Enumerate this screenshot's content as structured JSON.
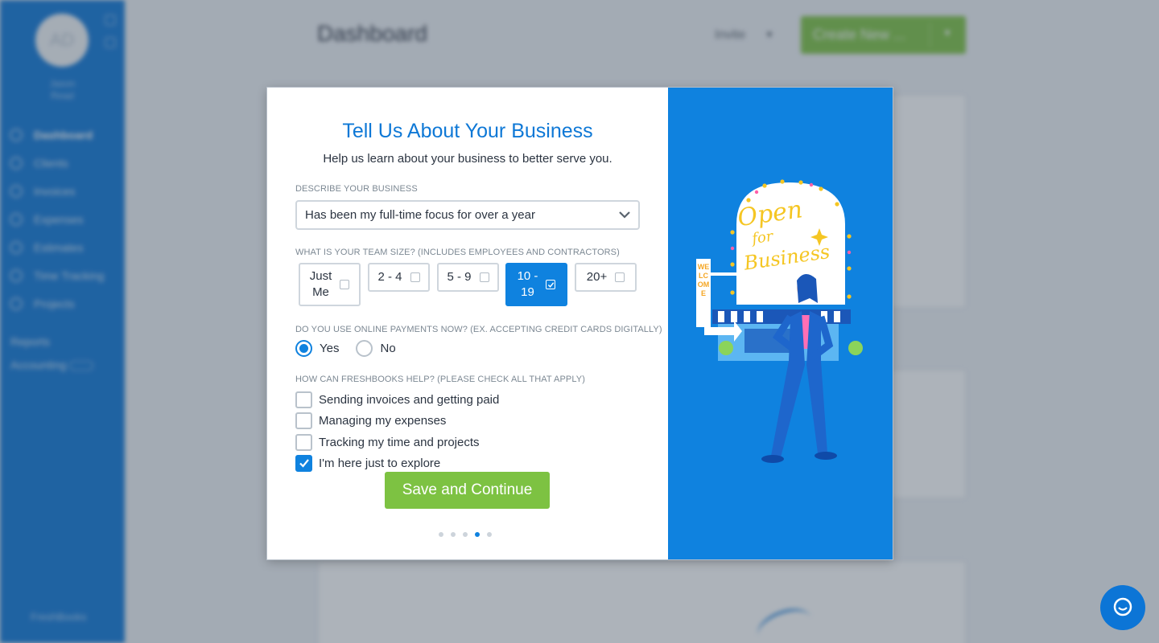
{
  "background": {
    "user": {
      "initials": "AD",
      "name_line1": "Jason",
      "name_line2": "Read"
    },
    "nav": [
      {
        "label": "Dashboard",
        "icon": "dashboard-icon",
        "active": true
      },
      {
        "label": "Clients",
        "icon": "clients-icon"
      },
      {
        "label": "Invoices",
        "icon": "invoices-icon"
      },
      {
        "label": "Expenses",
        "icon": "expenses-icon"
      },
      {
        "label": "Estimates",
        "icon": "estimates-icon"
      },
      {
        "label": "Time Tracking",
        "icon": "time-tracking-icon"
      },
      {
        "label": "Projects",
        "icon": "projects-icon"
      }
    ],
    "reports_label": "Reports",
    "accounting_label": "Accounting",
    "logo_text": "FreshBooks",
    "page_title": "Dashboard",
    "invite_label": "Invite",
    "create_label": "Create New ..."
  },
  "modal": {
    "title": "Tell Us About Your Business",
    "subtitle": "Help us learn about your business to better serve you.",
    "q1_label": "DESCRIBE YOUR BUSINESS",
    "q1_value": "Has been my full-time focus for over a year",
    "q2_label": "WHAT IS YOUR TEAM SIZE? (INCLUDES EMPLOYEES AND CONTRACTORS)",
    "team_options": [
      {
        "line1": "Just",
        "line2": "Me",
        "selected": false
      },
      {
        "line1": "2 - 4",
        "line2": "",
        "selected": false
      },
      {
        "line1": "5 - 9",
        "line2": "",
        "selected": false
      },
      {
        "line1": "10 -",
        "line2": "19",
        "selected": true
      },
      {
        "line1": "20+",
        "line2": "",
        "selected": false
      }
    ],
    "q3_label": "DO YOU USE ONLINE PAYMENTS NOW? (EX. ACCEPTING CREDIT CARDS DIGITALLY)",
    "q3_yes": "Yes",
    "q3_no": "No",
    "q3_selected": "Yes",
    "q4_label": "HOW CAN FRESHBOOKS HELP? (PLEASE CHECK ALL THAT APPLY)",
    "help_options": [
      {
        "label": "Sending invoices and getting paid",
        "checked": false
      },
      {
        "label": "Managing my expenses",
        "checked": false
      },
      {
        "label": "Tracking my time and projects",
        "checked": false
      },
      {
        "label": "I'm here just to explore",
        "checked": true
      }
    ],
    "save_label": "Save and Continue",
    "step_current": 4,
    "step_total": 5,
    "illustration": {
      "sign_line1": "Open",
      "sign_line2": "for",
      "sign_line3": "Business",
      "side_sign": "WELCOME"
    }
  },
  "colors": {
    "brand_blue": "#0f82df",
    "brand_green": "#7dc242",
    "title_blue": "#0e78d6"
  }
}
